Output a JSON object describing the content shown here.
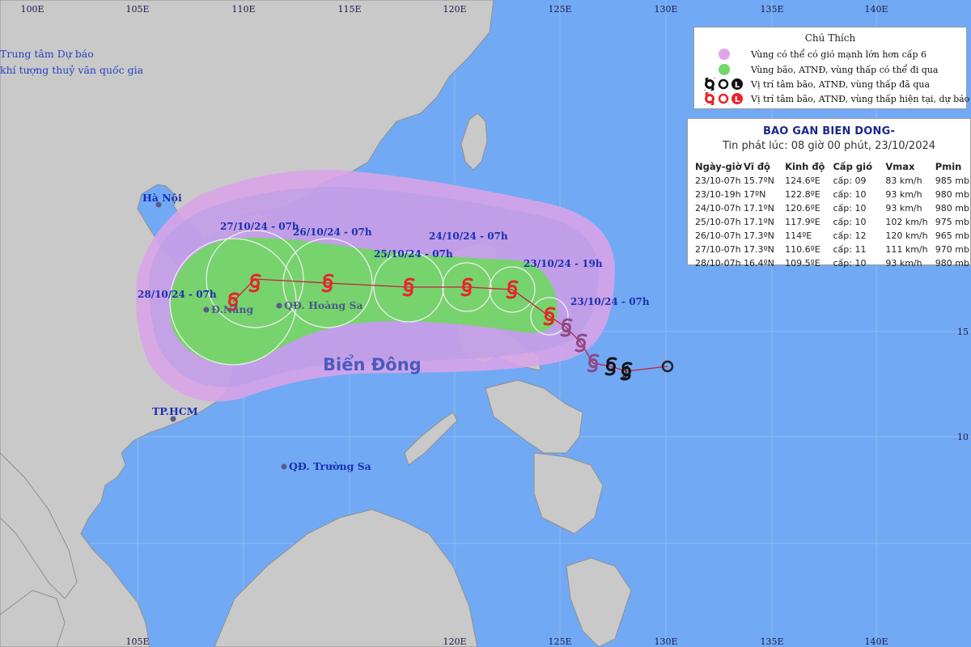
{
  "organization": [
    "Trung tâm Dự báo",
    "khí tượng thuỷ văn quốc gia"
  ],
  "axis": {
    "top_lon_labels": [
      "100E",
      "105E",
      "110E",
      "115E",
      "120E",
      "125E",
      "130E",
      "135E",
      "140E"
    ],
    "bottom_lon_labels": [
      "105E",
      "120E",
      "125E",
      "130E",
      "135E",
      "140E"
    ],
    "right_lat_labels": [
      "15",
      "10"
    ]
  },
  "places": {
    "hanoi": "Hà Nội",
    "danang": "Đ.Nẵng",
    "hoangsa": "QĐ. Hoàng Sa",
    "hcm": "TP.HCM",
    "truongsa": "QĐ. Trường Sa",
    "sea": "Biển Đông"
  },
  "track_labels": {
    "t23_07": "23/10/24 - 07h",
    "t23_19": "23/10/24 - 19h",
    "t24_07": "24/10/24 - 07h",
    "t25_07": "25/10/24 - 07h",
    "t26_07": "26/10/24 - 07h",
    "t27_07": "27/10/24 - 07h",
    "t28_07": "28/10/24 - 07h"
  },
  "legend": {
    "title": "Chú Thích",
    "items": [
      "Vùng có thể có gió mạnh lớn hơn cấp 6",
      "Vùng bão, ATNĐ, vùng thấp có thể đi qua",
      "Vị trí tâm bão, ATNĐ, vùng thấp đã qua",
      "Vị trí tâm bão, ATNĐ, vùng thấp hiện tại, dự báo"
    ],
    "colors": {
      "strong_wind_zone": "#e3a3e8",
      "storm_zone": "#72d86a",
      "past_symbol": "#222222",
      "forecast_symbol": "#e8242a"
    }
  },
  "bulletin": {
    "title": "BAO GAN BIEN DONG-",
    "issued": "Tin phát lúc: 08 giờ 00 phút, 23/10/2024",
    "columns": [
      "Ngày-giờ",
      "Vĩ độ",
      "Kinh độ",
      "Cấp gió",
      "Vmax",
      "Pmin"
    ],
    "rows": [
      [
        "23/10-07h",
        "15.7ºN",
        "124.6ºE",
        "cấp: 09",
        "83 km/h",
        "985 mb"
      ],
      [
        "23/10-19h",
        "17ºN",
        "122.8ºE",
        "cấp: 10",
        "93 km/h",
        "980 mb"
      ],
      [
        "24/10-07h",
        "17.1ºN",
        "120.6ºE",
        "cấp: 10",
        "93 km/h",
        "980 mb"
      ],
      [
        "25/10-07h",
        "17.1ºN",
        "117.9ºE",
        "cấp: 10",
        "102 km/h",
        "975 mb"
      ],
      [
        "26/10-07h",
        "17.3ºN",
        "114ºE",
        "cấp: 12",
        "120 km/h",
        "965 mb"
      ],
      [
        "27/10-07h",
        "17.3ºN",
        "110.6ºE",
        "cấp: 11",
        "111 km/h",
        "970 mb"
      ],
      [
        "28/10-07h",
        "16.4ºN",
        "109.5ºE",
        "cấp: 10",
        "93 km/h",
        "980 mb"
      ]
    ]
  },
  "colors": {
    "ocean": "#72a9f4",
    "land": "#c9c9c9",
    "land_stroke": "#8f8f8f",
    "track_line": "#c81e3c",
    "label_blue": "#1a2fb0"
  }
}
